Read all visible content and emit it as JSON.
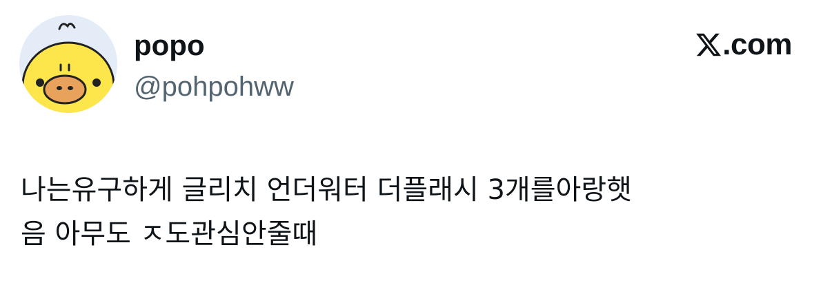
{
  "author": {
    "display_name": "popo",
    "handle": "@pohpohww",
    "avatar_icon": "yellow-chick-avatar"
  },
  "brand": {
    "logo_icon": "x-logo-icon",
    "text": ".com"
  },
  "tweet": {
    "lines": [
      "나는유구하게 글리치 언더워터 더플래시 3개를아랑햇",
      "음 아무도 ㅈ도관심안줄때"
    ]
  },
  "colors": {
    "text": "#0f1419",
    "secondary": "#536471",
    "avatar_bg": "#e4ecf7",
    "chick_yellow": "#fde64b",
    "beak": "#e9a25c"
  }
}
